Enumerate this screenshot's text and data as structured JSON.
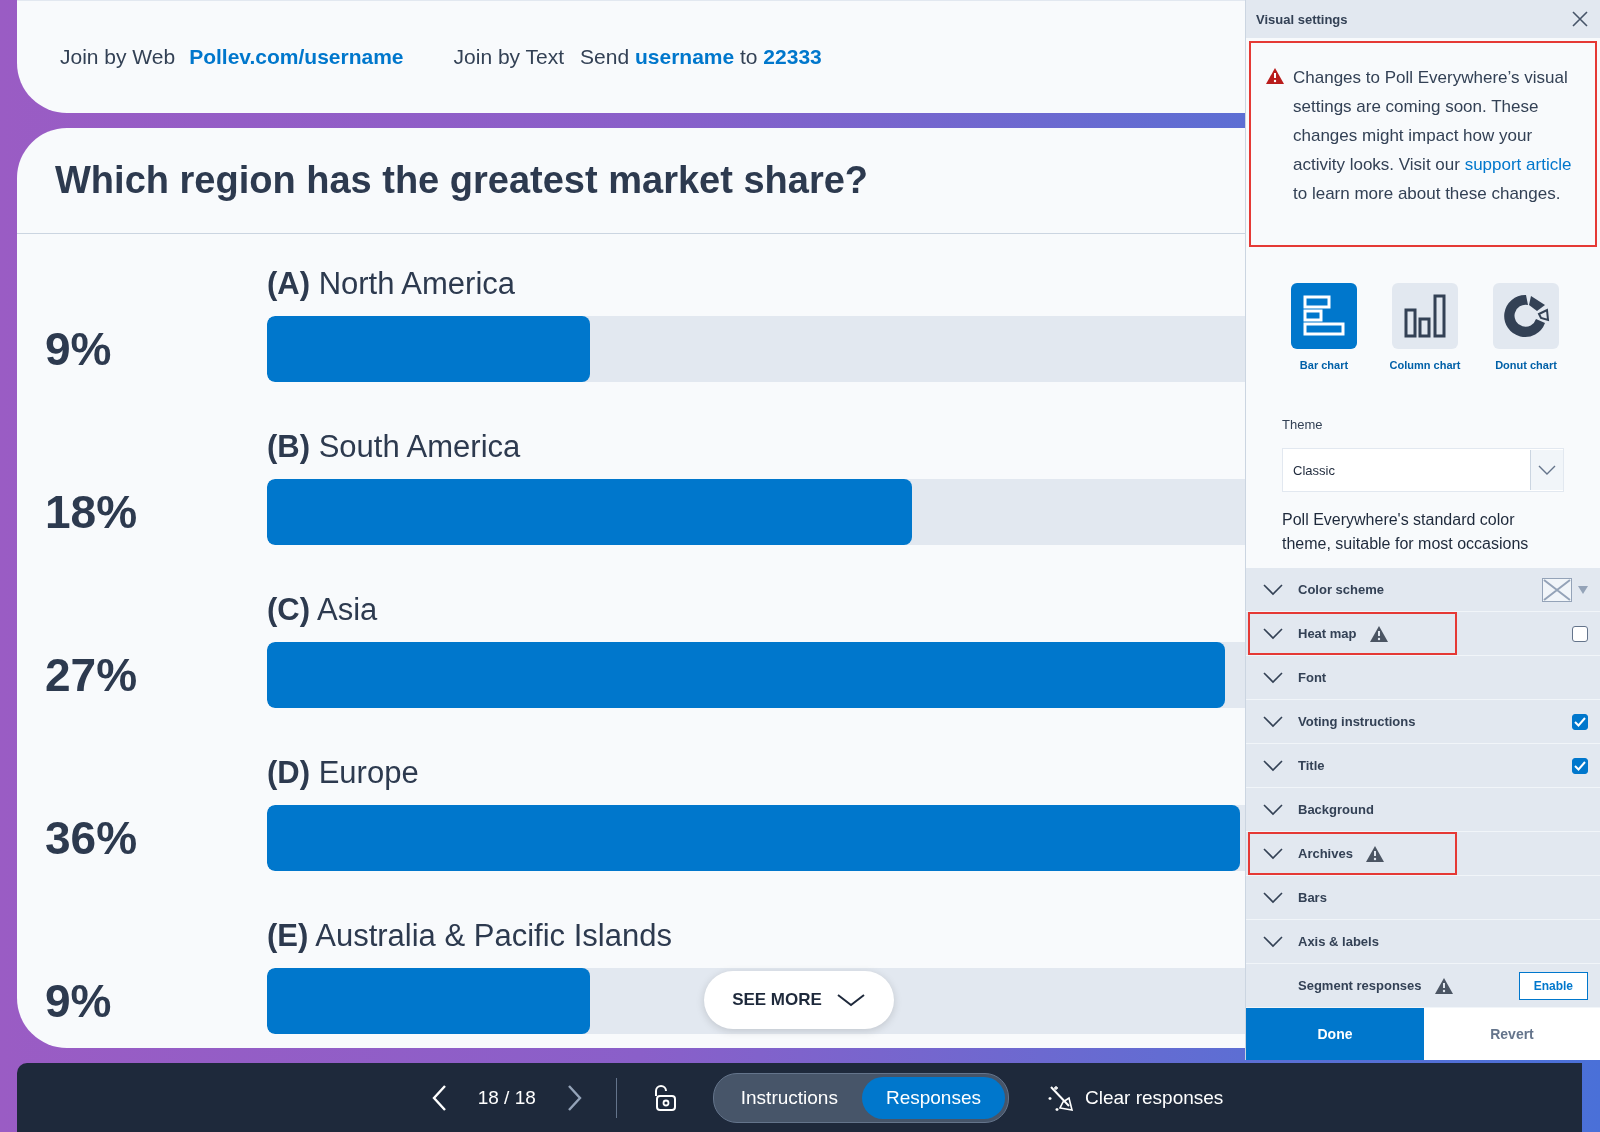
{
  "join": {
    "web_label": "Join by Web",
    "web_url": "Pollev.com/username",
    "text_label": "Join by Text",
    "text_message": "Send **username** to **22333**"
  },
  "poll": {
    "question": "Which region has the greatest market share?",
    "options": [
      {
        "label": "North America",
        "letter": "(A)",
        "percent": "9%",
        "level": 0.33
      },
      {
        "label": "South America",
        "letter": "(B)",
        "percent": "18%",
        "level": 0.66
      },
      {
        "label": "Asia",
        "letter": "(C)",
        "percent": "27%",
        "level": 0.98
      },
      {
        "label": "Europe",
        "letter": "(D)",
        "percent": "36%",
        "level": 0.995
      },
      {
        "label": "Australia & Pacific Islands",
        "letter": "(E)",
        "percent": "9%",
        "level": 0.33
      }
    ],
    "see_more": "SEE MORE"
  },
  "panel": {
    "title": "Visual settings",
    "alert": {
      "text_before": "Changes to Poll Everywhere’s visual settings are coming soon. These changes might impact how your activity looks. Visit our",
      "link": "support article",
      "text_after": "to learn more about these changes.",
      "highlighted": true
    },
    "chart_types": [
      {
        "label": "Bar chart",
        "kind": "bar",
        "selected": true
      },
      {
        "label": "Column chart",
        "kind": "column",
        "selected": false
      },
      {
        "label": "Donut chart",
        "kind": "donut",
        "selected": false
      }
    ],
    "theme": {
      "label": "Theme",
      "value": "Classic",
      "description": "Poll Everywhere's standard color theme, suitable for most occasions"
    },
    "settings": [
      {
        "label": "Color scheme",
        "kind": "swatch",
        "warning": false,
        "highlighted": false
      },
      {
        "label": "Heat map",
        "kind": "checkbox",
        "checked": false,
        "warning": true,
        "highlighted": true
      },
      {
        "label": "Font",
        "kind": "plain",
        "warning": false,
        "highlighted": false
      },
      {
        "label": "Voting instructions",
        "kind": "checkbox",
        "checked": true,
        "warning": false,
        "highlighted": false
      },
      {
        "label": "Title",
        "kind": "checkbox",
        "checked": true,
        "warning": false,
        "highlighted": false
      },
      {
        "label": "Background",
        "kind": "plain",
        "warning": false,
        "highlighted": false
      },
      {
        "label": "Archives",
        "kind": "plain",
        "warning": true,
        "highlighted": true
      },
      {
        "label": "Bars",
        "kind": "plain",
        "warning": false,
        "highlighted": false
      },
      {
        "label": "Axis & labels",
        "kind": "plain",
        "warning": false,
        "highlighted": false
      },
      {
        "label": "Segment responses",
        "kind": "button",
        "button": "Enable",
        "warning": true,
        "highlighted": false
      }
    ],
    "done": "Done",
    "revert": "Revert"
  },
  "toolbar": {
    "page": "18 / 18",
    "segments": [
      {
        "label": "Instructions",
        "selected": false
      },
      {
        "label": "Responses",
        "selected": true
      }
    ],
    "clear": "Clear responses"
  }
}
